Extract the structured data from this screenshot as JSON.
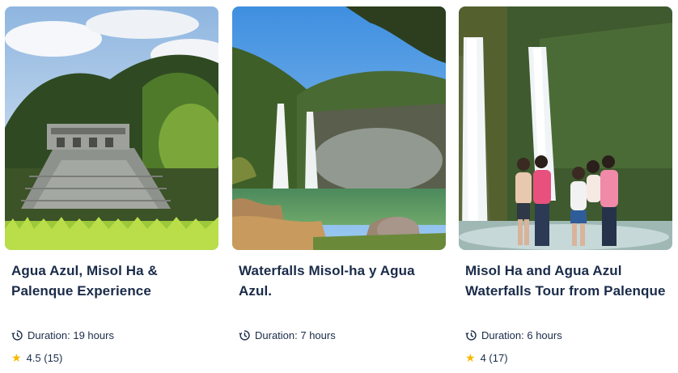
{
  "cards": [
    {
      "title": "Agua Azul, Misol Ha & Palenque Experience",
      "duration": "Duration: 19 hours",
      "rating": "4.5 (15)",
      "image": "palenque-temple-photo"
    },
    {
      "title": "Waterfalls Misol-ha y Agua Azul.",
      "duration": "Duration: 7 hours",
      "rating": "",
      "image": "misol-ha-waterfall-photo"
    },
    {
      "title": "Misol Ha and Agua Azul Waterfalls Tour from Palenque",
      "duration": "Duration: 6 hours",
      "rating": "4 (17)",
      "image": "waterfall-group-photo"
    }
  ],
  "icons": {
    "duration": "clock-icon",
    "rating": "star-icon"
  },
  "colors": {
    "text": "#1a2b49",
    "star": "#f9b800"
  }
}
